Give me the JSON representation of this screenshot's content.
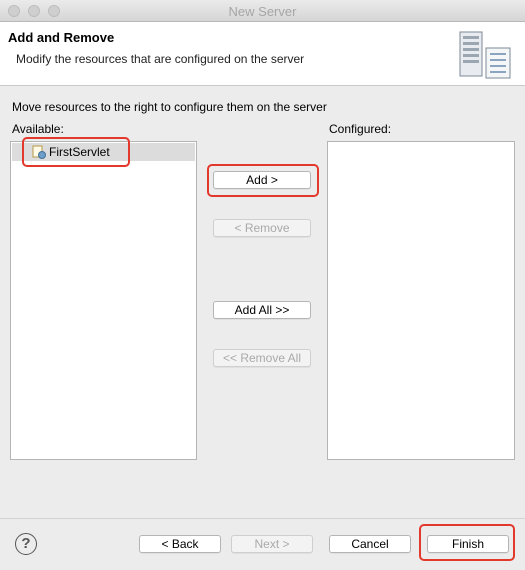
{
  "window": {
    "title": "New Server"
  },
  "header": {
    "title": "Add and Remove",
    "description": "Modify the resources that are configured on the server",
    "icon": "server-icon"
  },
  "main": {
    "instructions": "Move resources to the right to configure them on the server",
    "available_label": "Available:",
    "configured_label": "Configured:",
    "available_items": [
      {
        "label": "FirstServlet",
        "icon": "web-project-icon",
        "selected": true
      }
    ],
    "configured_items": []
  },
  "actions": {
    "add": "Add >",
    "remove": "< Remove",
    "add_all": "Add All >>",
    "remove_all": "<< Remove All"
  },
  "footer": {
    "back": "< Back",
    "next": "Next >",
    "cancel": "Cancel",
    "finish": "Finish",
    "help_icon": "help-icon"
  },
  "colors": {
    "highlight": "#e2392c",
    "selection": "#dcdcdc"
  }
}
